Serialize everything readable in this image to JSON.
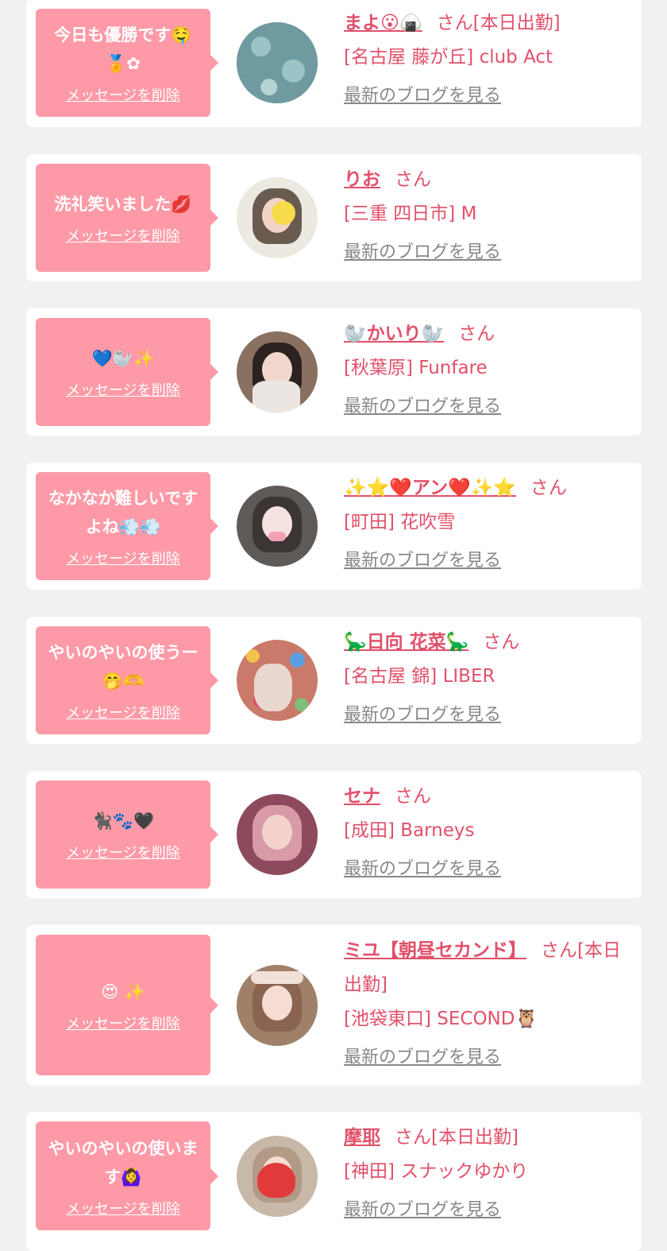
{
  "cards": [
    {
      "message": "今日も優勝です🤤 🏅✿",
      "delete_label": "メッセージを削除",
      "name": "まよ😮🍙",
      "name_suffix": "さん[本日出勤]",
      "shop": "[名古屋 藤が丘] club Act",
      "blog_label": "最新のブログを見る",
      "avatar_colors": [
        "#6e9aa0",
        "#9cc4c6"
      ]
    },
    {
      "message": "洗礼笑いました💋",
      "delete_label": "メッセージを削除",
      "name": "りお",
      "name_suffix": "さん",
      "shop": "[三重 四日市] M",
      "blog_label": "最新のブログを見る",
      "avatar_colors": [
        "#ece9e1",
        "#6a5b50"
      ]
    },
    {
      "message": "💙🦭✨",
      "delete_label": "メッセージを削除",
      "name": "🦭かいり🦭",
      "name_suffix": "さん",
      "shop": "[秋葉原] Funfare",
      "blog_label": "最新のブログを見る",
      "avatar_colors": [
        "#8a7060",
        "#2b2120"
      ]
    },
    {
      "message": "なかなか難しいですよね💨💨",
      "delete_label": "メッセージを削除",
      "name": "✨⭐❤️アン❤️✨⭐",
      "name_suffix": "さん",
      "shop": "[町田] 花吹雪",
      "blog_label": "最新のブログを見る",
      "avatar_colors": [
        "#5e5a58",
        "#3b3633"
      ]
    },
    {
      "message": "やいのやいの使うー🤭🫶",
      "delete_label": "メッセージを削除",
      "name": "🦕日向 花菜🦕",
      "name_suffix": "さん",
      "shop": "[名古屋 錦] LIBER",
      "blog_label": "最新のブログを見る",
      "avatar_colors": [
        "#c97a6a",
        "#e9d8d0"
      ]
    },
    {
      "message": "🐈‍⬛🐾🖤",
      "delete_label": "メッセージを削除",
      "name": "セナ",
      "name_suffix": "さん",
      "shop": "[成田] Barneys",
      "blog_label": "最新のブログを見る",
      "avatar_colors": [
        "#8c4a5c",
        "#d79aa6"
      ]
    },
    {
      "message": "😍 ✨",
      "delete_label": "メッセージを削除",
      "name": "ミユ【朝昼セカンド】",
      "name_suffix": "さん[本日出勤]",
      "shop": "[池袋東口] SECOND🦉",
      "blog_label": "最新のブログを見る",
      "avatar_colors": [
        "#a08068",
        "#f1e0d8"
      ]
    },
    {
      "message": "やいのやいの使います🙆‍♀️",
      "delete_label": "メッセージを削除",
      "name": "摩耶",
      "name_suffix": "さん[本日出勤]",
      "shop": "[神田] スナックゆかり",
      "blog_label": "最新のブログを見る",
      "avatar_colors": [
        "#c8b8a8",
        "#e23a3a"
      ]
    }
  ]
}
